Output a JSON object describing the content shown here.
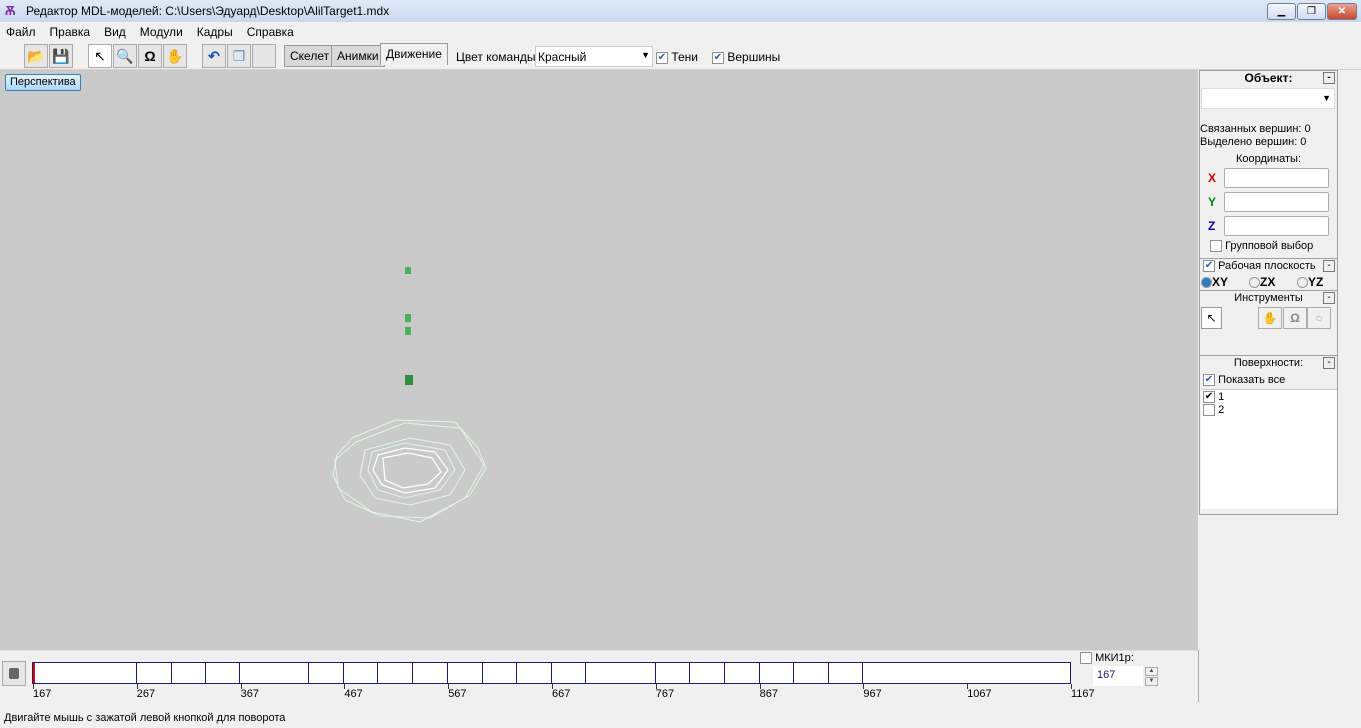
{
  "window": {
    "title": "Редактор MDL-моделей: C:\\Users\\Эдуард\\Desktop\\AlilTarget1.mdx"
  },
  "menu": [
    "Файл",
    "Правка",
    "Вид",
    "Модули",
    "Кадры",
    "Справка"
  ],
  "tabs": [
    {
      "label": "Скелет"
    },
    {
      "label": "Анимки"
    },
    {
      "label": "Движение",
      "active": true
    }
  ],
  "toolbar": {
    "team_color_label": "Цвет команды:",
    "team_color_value": "Красный",
    "shadows_label": "Тени",
    "shadows_checked": true,
    "vertices_label": "Вершины",
    "vertices_checked": true
  },
  "viewport": {
    "view_button": "Перспектива",
    "background": "#cacaca"
  },
  "panel": {
    "object_header": "Объект:",
    "linked_vertices": "Связанных вершин: 0",
    "selected_vertices": "Выделено вершин: 0",
    "coords_label": "Координаты:",
    "x": "X",
    "y": "Y",
    "z": "Z",
    "group_select": "Групповой выбор",
    "work_plane": "Рабочая плоскость",
    "planes": [
      "XY",
      "ZX",
      "YZ"
    ],
    "selected_plane": "XY",
    "tools_header": "Инструменты",
    "surfaces_header": "Поверхности:",
    "show_all": "Показать все",
    "surfaces": [
      {
        "label": "1",
        "checked": true
      },
      {
        "label": "2",
        "checked": false
      }
    ]
  },
  "timeline": {
    "labels": [
      "167",
      "267",
      "367",
      "467",
      "567",
      "667",
      "767",
      "867",
      "967",
      "1067",
      "1167"
    ],
    "mki_label": "МКИ1р:",
    "frame": "167",
    "current_frame": 167
  },
  "status": "Двигайте мышь с зажатой левой кнопкой для поворота"
}
